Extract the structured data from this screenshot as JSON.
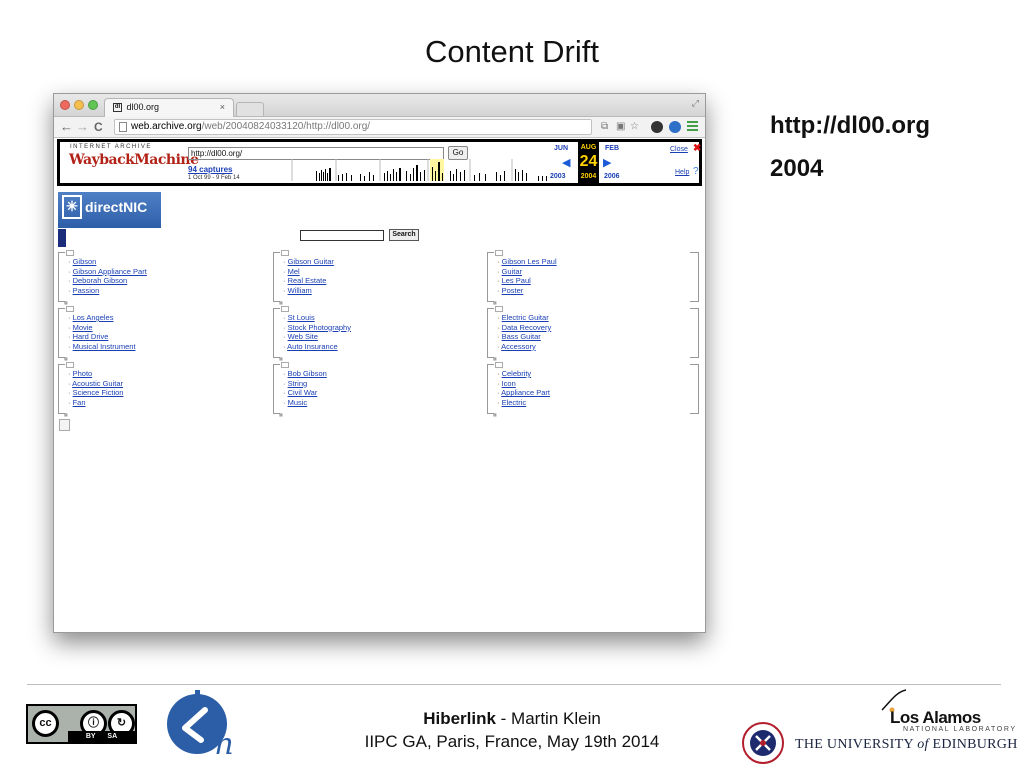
{
  "slide": {
    "title": "Content Drift",
    "side_url": "http://dl00.org",
    "side_year": "2004"
  },
  "browser": {
    "tab_title": "dl00.org",
    "tab_favicon": "dl",
    "tab_close": "×",
    "address": {
      "host": "web.archive.org",
      "path": "/web/20040824033120/http://dl00.org/"
    }
  },
  "wayback": {
    "ia_label": "INTERNET ARCHIVE",
    "logo_text": "WaybackMachine",
    "url_value": "http://dl00.org/",
    "go_label": "Go",
    "captures": "94 captures",
    "range": "1 Oct 99 - 9 Feb 14",
    "month_prev": "JUN",
    "month_cur": "AUG",
    "month_next": "FEB",
    "day": "24",
    "year_prev": "2003",
    "year_cur": "2004",
    "year_next": "2006",
    "close_label": "Close",
    "help_label": "Help",
    "help_q": "?"
  },
  "page": {
    "logo_text": "directNIC",
    "search_label": "Search",
    "columns": [
      [
        [
          "Gibson",
          "Gibson Appliance Part",
          "Deborah Gibson",
          "Passion"
        ],
        [
          "Los Angeles",
          "Movie",
          "Hard Drive",
          "Musical Instrument"
        ],
        [
          "Photo",
          "Acoustic Guitar",
          "Science Fiction",
          "Fan"
        ]
      ],
      [
        [
          "Gibson Guitar",
          "Mel",
          "Real Estate",
          "William"
        ],
        [
          "St Louis",
          "Stock Photography",
          "Web Site",
          "Auto Insurance"
        ],
        [
          "Bob Gibson",
          "String",
          "Civil War",
          "Music"
        ]
      ],
      [
        [
          "Gibson Les Paul",
          "Guitar",
          "Les Paul",
          "Poster"
        ],
        [
          "Electric Guitar",
          "Data Recovery",
          "Bass Guitar",
          "Accessory"
        ],
        [
          "Celebrity",
          "Icon",
          "Appliance Part",
          "Electric"
        ]
      ]
    ]
  },
  "footer": {
    "cc_by": "BY",
    "cc_sa": "SA",
    "project": "Hiberlink",
    "author": " - Martin Klein",
    "event": "IIPC GA, Paris, France, May 19th 2014",
    "la_name": "Los Alamos",
    "la_sub": "NATIONAL LABORATORY",
    "ed_prefix": "THE UNIVERSITY ",
    "ed_of": "of",
    "ed_suffix": " EDINBURGH"
  }
}
